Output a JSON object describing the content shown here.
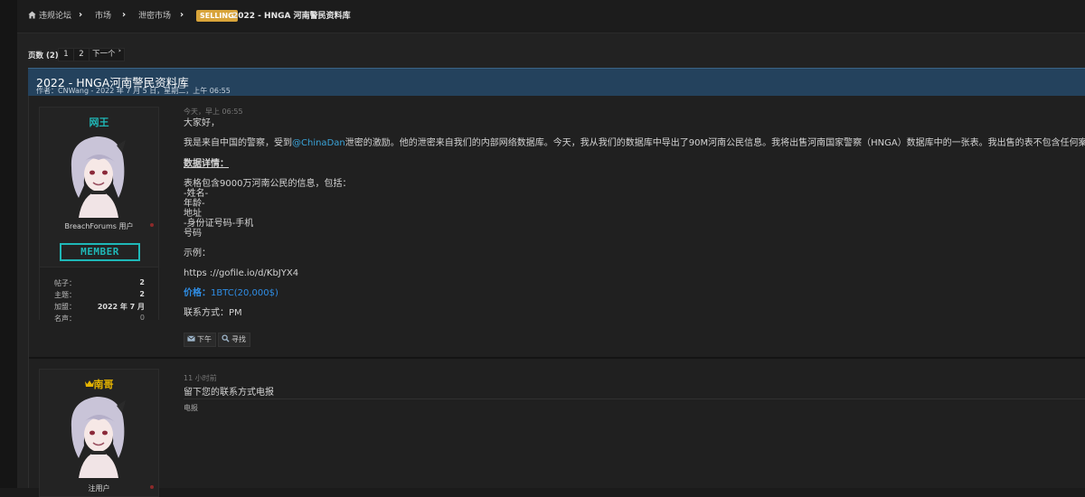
{
  "breadcrumb": {
    "home": "违规论坛",
    "market": "市场",
    "leaks_market": "泄密市场",
    "badge": "SELLING",
    "title": "2022 - HNGA 河南警民资料库"
  },
  "pagination": {
    "label": "页数 (2):",
    "pages": [
      "1",
      "2"
    ],
    "next": "下一个 ˃"
  },
  "thread": {
    "title": "2022 - HNGA河南警民资料库",
    "meta": "作者：CNWang - 2022 年 7 月 5 日，星期二，上午 06:55"
  },
  "post1": {
    "user": {
      "name": "网王",
      "name_color": "#1fb8b8",
      "title": "BreachForums 用户",
      "rank_badge": "MEMBER",
      "stats": [
        {
          "label": "帖子：",
          "value": "2"
        },
        {
          "label": "主题：",
          "value": "2"
        },
        {
          "label": "加盟：",
          "value": "2022 年 7 月"
        },
        {
          "label": "名声：",
          "value": "0"
        }
      ]
    },
    "date": "今天，早上 06:55",
    "greeting": "大家好，",
    "intro_before": "我是来自中国的警察，受到",
    "mention": "@ChinaDan",
    "intro_after": "泄密的激励。他的泄密来自我们的内部网络数据库。今天，我从我们的数据库中导出了90M河南公民信息。我将出售河南国家警察（HNGA）数据库中的一张表。我出售的表不包含任何案件信息。",
    "details_heading": "数据详情：",
    "table_line": "表格包含9000万河南公民的信息，包括：",
    "fields": [
      "-姓名-",
      "年龄-",
      "地址",
      "-身份证号码-手机",
      "号码"
    ],
    "example_label": "示例：",
    "example_link": "https ://gofile.io/d/KbJYX4",
    "price_label": "价格：",
    "price_value": "1BTC(20,000$)",
    "contact": "联系方式：PM",
    "btn_pm": "下午",
    "btn_find": "寻找"
  },
  "post2": {
    "user": {
      "name": "南哥",
      "name_color": "#e6b400",
      "title": "注用户"
    },
    "date": "11 小时前",
    "text": "留下您的联系方式电报",
    "signature": "电报"
  }
}
